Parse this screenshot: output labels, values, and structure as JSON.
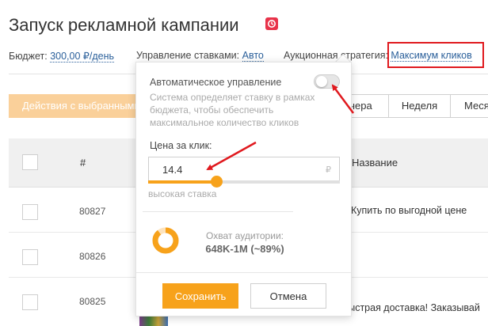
{
  "page": {
    "title": "Запуск рекламной кампании"
  },
  "settings": {
    "budget_label": "Бюджет:",
    "budget_value": "300,00 ₽/день",
    "bid_label": "Управление ставками:",
    "bid_value": "Авто",
    "strategy_label": "Аукционная стратегия:",
    "strategy_value": "Максимум кликов"
  },
  "toolbar": {
    "actions_label": "Действия с выбранными",
    "periods": [
      "Вчера",
      "Неделя",
      "Месяц"
    ]
  },
  "table": {
    "col_number": "#",
    "col_name": "Название",
    "rows": [
      {
        "number": "80827",
        "text": "Купить по выгодной цене"
      },
      {
        "number": "80826",
        "text": ""
      },
      {
        "number": "80825",
        "text": "Быстрая доставка! Заказывай"
      }
    ]
  },
  "popup": {
    "auto_label": "Автоматическое управление",
    "auto_enabled": false,
    "auto_desc": "Система определяет ставку в рамках бюджета, чтобы обеспечить максимальное количество кликов",
    "price_label": "Цена за клик:",
    "price_value": "14.4",
    "currency": "₽",
    "slider_level": 0.36,
    "bid_hint": "высокая ставка",
    "reach_label": "Охват аудитории:",
    "reach_value": "648K-1M (~89%)",
    "reach_fraction": 0.89,
    "save_label": "Сохранить",
    "cancel_label": "Отмена"
  },
  "colors": {
    "accent": "#f7a21b",
    "link": "#2a5f9a",
    "highlight": "#e0191e",
    "badge": "#e8334a"
  },
  "icons": {
    "title_badge": "campaign-badge-icon",
    "currency": "ruble-icon"
  }
}
